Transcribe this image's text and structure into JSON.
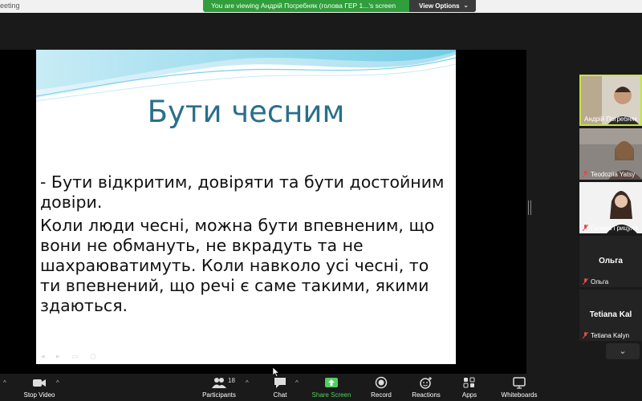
{
  "window": {
    "title_fragment": "eeting"
  },
  "share_banner": {
    "text": "You are viewing Андрій Погребняк (голова ГЕР 1...'s screen",
    "view_options": "View Options"
  },
  "slide": {
    "title": "Бути чесним",
    "paragraphs": [
      "- Бути відкритим, довіряти та бути достойним довіри.",
      "Коли люди чесні, можна бути впевненим, що вони не обмануть, не вкрадуть та не шахраюватимуть. Коли навколо усі чесні, то ти впевнений, що речі є саме такими, якими здаються."
    ]
  },
  "participants": [
    {
      "name": "Андрій Погребняк",
      "active": true,
      "muted": false,
      "video": true
    },
    {
      "name": "Teodoziia Yatsy",
      "active": false,
      "muted": true,
      "video": true
    },
    {
      "name": "Галина Грицула",
      "active": false,
      "muted": true,
      "video": true
    },
    {
      "name": "Ольга",
      "display": "Ольга",
      "active": false,
      "muted": true,
      "video": false
    },
    {
      "name": "Tetiana Kalyn",
      "display": "Tetiana Kal",
      "active": false,
      "muted": true,
      "video": false
    }
  ],
  "toolbar": {
    "stop_video": "Stop Video",
    "participants": "Participants",
    "participants_count": "18",
    "chat": "Chat",
    "share_screen": "Share Screen",
    "record": "Record",
    "reactions": "Reactions",
    "apps": "Apps",
    "whiteboards": "Whiteboards"
  },
  "colors": {
    "accent_green": "#2f9e3b",
    "share_green": "#4fd060",
    "active_border": "#c7e33f",
    "title_blue": "#2a6f8a"
  },
  "icons": [
    "chevron-down-icon",
    "video-camera-icon",
    "participants-icon",
    "chat-icon",
    "share-screen-icon",
    "record-icon",
    "reactions-icon",
    "apps-icon",
    "whiteboard-icon",
    "mic-muted-icon",
    "mouse-cursor-icon"
  ]
}
